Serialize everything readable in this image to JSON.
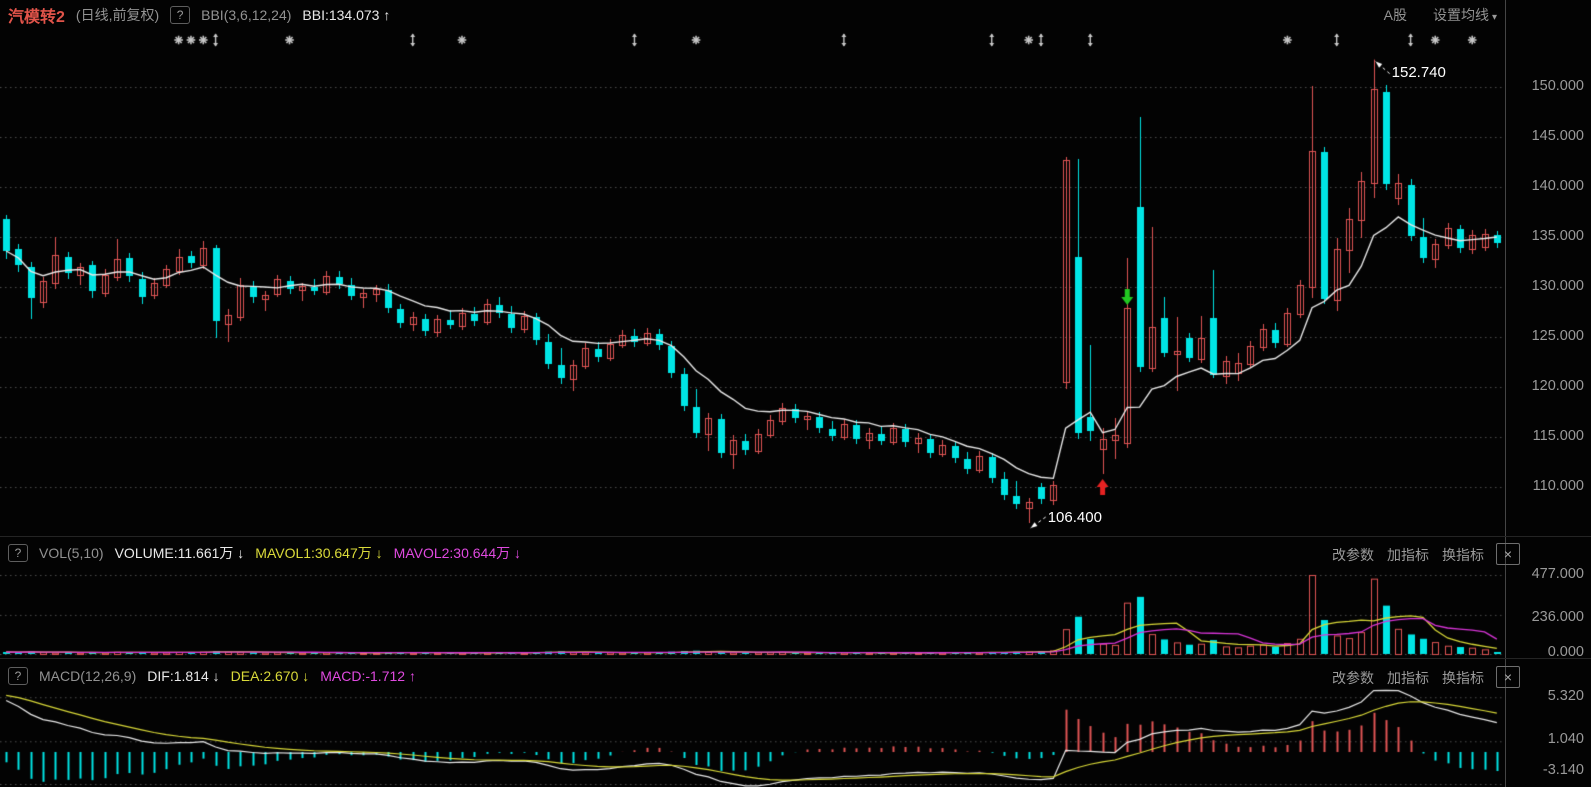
{
  "header": {
    "symbol": "汽模转2",
    "mode": "(日线,前复权)",
    "help": "?",
    "indicator_params": "BBI(3,6,12,24)",
    "indicator_value": "BBI:134.073 ↑",
    "market": "A股",
    "ma_settings": "设置均线",
    "caret": "▾"
  },
  "vol_pane": {
    "help": "?",
    "name": "VOL(5,10)",
    "volume": "VOLUME:11.661万 ↓",
    "mavol1": "MAVOL1:30.647万 ↓",
    "mavol2": "MAVOL2:30.644万 ↓",
    "menu": {
      "edit": "改参数",
      "add": "加指标",
      "switch": "换指标",
      "close": "×"
    },
    "axis": [
      "477.000",
      "236.000",
      "0.000"
    ]
  },
  "macd_pane": {
    "help": "?",
    "name": "MACD(12,26,9)",
    "dif": "DIF:1.814 ↓",
    "dea": "DEA:2.670 ↓",
    "macd": "MACD:-1.712 ↑",
    "menu": {
      "edit": "改参数",
      "add": "加指标",
      "switch": "换指标",
      "close": "×"
    },
    "axis": [
      "5.320",
      "1.040",
      "-3.140"
    ]
  },
  "main_axis": [
    "150.000",
    "145.000",
    "140.000",
    "135.000",
    "130.000",
    "125.000",
    "120.000",
    "115.000",
    "110.000"
  ],
  "annotations": {
    "high": {
      "index": 111,
      "price": 152.74,
      "label": "152.740"
    },
    "low": {
      "index": 83,
      "price": 106.4,
      "label": "106.400"
    }
  },
  "chart_data": {
    "type": "candlestick",
    "title": "汽模转2 日线 前复权",
    "overlay_line": "BBI(3,6,12,24)",
    "price_ylim": [
      105.5,
      155.9
    ],
    "price_gridlines": [
      150,
      145,
      140,
      135,
      130,
      125,
      120,
      115,
      110
    ],
    "volume_gridlines": [
      477,
      236,
      0
    ],
    "volume_ylim": [
      0,
      477
    ],
    "macd_gridlines": [
      5.32,
      1.04,
      -3.14
    ],
    "legend": {
      "up_candle": "red hollow",
      "down_candle": "cyan filled",
      "main_line": "BBI white",
      "vol_lines": [
        "MAVOL1 yellow",
        "MAVOL2 magenta"
      ],
      "macd_lines": [
        "DIF white",
        "DEA yellow"
      ]
    },
    "candles": [
      [
        136.8,
        137.2,
        132.8,
        133.6
      ],
      [
        133.8,
        134.3,
        131.5,
        132.2
      ],
      [
        132.0,
        132.5,
        126.8,
        128.9
      ],
      [
        128.5,
        131.0,
        127.9,
        130.6
      ],
      [
        130.4,
        135.0,
        129.8,
        133.2
      ],
      [
        133.0,
        133.5,
        130.8,
        131.4
      ],
      [
        131.2,
        132.4,
        130.2,
        132.0
      ],
      [
        132.2,
        132.6,
        128.9,
        129.6
      ],
      [
        129.4,
        131.8,
        129.0,
        131.2
      ],
      [
        131.0,
        134.8,
        130.6,
        132.8
      ],
      [
        132.9,
        133.4,
        130.5,
        131.1
      ],
      [
        130.8,
        131.5,
        128.3,
        129.0
      ],
      [
        129.2,
        130.9,
        128.8,
        130.4
      ],
      [
        130.2,
        132.2,
        129.9,
        131.8
      ],
      [
        131.6,
        133.8,
        131.2,
        133.0
      ],
      [
        133.1,
        133.6,
        131.9,
        132.4
      ],
      [
        132.2,
        134.6,
        131.8,
        133.9
      ],
      [
        133.9,
        134.2,
        124.9,
        126.6
      ],
      [
        126.3,
        127.8,
        124.5,
        127.2
      ],
      [
        127.0,
        130.9,
        126.6,
        130.2
      ],
      [
        130.0,
        130.6,
        128.4,
        129.0
      ],
      [
        128.8,
        129.6,
        127.6,
        129.2
      ],
      [
        129.3,
        131.2,
        129.0,
        130.8
      ],
      [
        130.6,
        131.1,
        129.3,
        129.8
      ],
      [
        129.7,
        130.4,
        128.6,
        130.1
      ],
      [
        130.0,
        130.8,
        129.2,
        129.6
      ],
      [
        129.5,
        131.6,
        129.2,
        131.1
      ],
      [
        131.0,
        131.6,
        129.8,
        130.3
      ],
      [
        130.2,
        130.9,
        128.7,
        129.1
      ],
      [
        129.0,
        129.8,
        127.9,
        129.4
      ],
      [
        129.3,
        130.2,
        128.5,
        129.8
      ],
      [
        129.7,
        130.3,
        127.4,
        127.9
      ],
      [
        127.8,
        128.3,
        125.9,
        126.4
      ],
      [
        126.3,
        127.5,
        125.6,
        127.0
      ],
      [
        126.8,
        127.3,
        125.1,
        125.6
      ],
      [
        125.5,
        127.2,
        125.0,
        126.8
      ],
      [
        126.7,
        127.7,
        125.8,
        126.2
      ],
      [
        126.1,
        127.9,
        125.7,
        127.4
      ],
      [
        127.3,
        128.0,
        126.1,
        126.6
      ],
      [
        126.5,
        128.8,
        126.2,
        128.3
      ],
      [
        128.2,
        129.0,
        126.9,
        127.4
      ],
      [
        127.3,
        128.1,
        125.4,
        125.9
      ],
      [
        125.8,
        127.6,
        125.4,
        127.1
      ],
      [
        127.0,
        127.4,
        124.2,
        124.7
      ],
      [
        124.5,
        125.3,
        121.8,
        122.3
      ],
      [
        122.2,
        123.9,
        120.3,
        120.9
      ],
      [
        120.8,
        122.7,
        119.6,
        122.2
      ],
      [
        122.1,
        124.4,
        121.8,
        123.9
      ],
      [
        123.8,
        124.5,
        122.5,
        123.0
      ],
      [
        122.9,
        124.8,
        122.6,
        124.3
      ],
      [
        124.2,
        125.7,
        123.9,
        125.2
      ],
      [
        125.1,
        125.8,
        124.0,
        124.5
      ],
      [
        124.4,
        125.9,
        124.1,
        125.4
      ],
      [
        125.3,
        125.8,
        123.7,
        124.2
      ],
      [
        124.1,
        124.6,
        120.9,
        121.4
      ],
      [
        121.3,
        121.9,
        117.6,
        118.1
      ],
      [
        118.0,
        119.8,
        114.9,
        115.4
      ],
      [
        115.3,
        117.4,
        113.6,
        116.9
      ],
      [
        116.8,
        117.3,
        112.9,
        113.4
      ],
      [
        113.3,
        115.2,
        111.8,
        114.7
      ],
      [
        114.6,
        115.3,
        113.2,
        113.7
      ],
      [
        113.6,
        115.8,
        113.3,
        115.3
      ],
      [
        115.2,
        117.2,
        114.9,
        116.7
      ],
      [
        116.6,
        118.4,
        116.2,
        117.9
      ],
      [
        117.8,
        118.3,
        116.4,
        116.9
      ],
      [
        116.8,
        117.6,
        115.7,
        117.1
      ],
      [
        117.0,
        117.5,
        115.4,
        115.9
      ],
      [
        115.8,
        116.6,
        114.6,
        115.1
      ],
      [
        115.0,
        116.8,
        114.7,
        116.3
      ],
      [
        116.2,
        116.7,
        114.3,
        114.8
      ],
      [
        114.7,
        115.9,
        113.8,
        115.4
      ],
      [
        115.3,
        116.1,
        114.2,
        114.6
      ],
      [
        114.5,
        116.4,
        114.2,
        115.9
      ],
      [
        115.8,
        116.3,
        114.0,
        114.5
      ],
      [
        114.4,
        115.4,
        113.4,
        114.9
      ],
      [
        114.8,
        115.2,
        112.9,
        113.4
      ],
      [
        113.3,
        114.7,
        113.0,
        114.2
      ],
      [
        114.1,
        114.6,
        112.4,
        112.9
      ],
      [
        112.8,
        113.5,
        111.3,
        111.8
      ],
      [
        111.7,
        113.6,
        111.4,
        113.1
      ],
      [
        113.0,
        113.4,
        110.4,
        110.9
      ],
      [
        110.8,
        111.5,
        108.7,
        109.2
      ],
      [
        109.1,
        110.6,
        107.8,
        108.3
      ],
      [
        107.9,
        108.9,
        106.4,
        108.5
      ],
      [
        110.0,
        110.4,
        108.3,
        108.8
      ],
      [
        108.7,
        110.6,
        108.2,
        110.2
      ],
      [
        120.5,
        143.0,
        119.8,
        142.7
      ],
      [
        133.0,
        142.8,
        114.8,
        115.4
      ],
      [
        117.0,
        124.2,
        114.6,
        115.6
      ],
      [
        113.8,
        115.9,
        111.3,
        114.8
      ],
      [
        114.7,
        116.9,
        112.8,
        115.2
      ],
      [
        114.4,
        132.9,
        113.9,
        127.9
      ],
      [
        138.0,
        147.0,
        121.5,
        122.0
      ],
      [
        121.9,
        136.0,
        121.5,
        126.0
      ],
      [
        126.9,
        129.0,
        123.0,
        123.4
      ],
      [
        123.3,
        127.0,
        119.6,
        123.6
      ],
      [
        124.9,
        125.4,
        122.5,
        122.9
      ],
      [
        122.8,
        127.1,
        122.4,
        124.9
      ],
      [
        126.9,
        131.7,
        120.9,
        121.2
      ],
      [
        121.1,
        123.1,
        120.3,
        122.6
      ],
      [
        121.4,
        123.4,
        120.6,
        122.4
      ],
      [
        122.3,
        124.6,
        121.9,
        124.1
      ],
      [
        124.0,
        126.3,
        123.6,
        125.8
      ],
      [
        125.7,
        126.4,
        123.9,
        124.4
      ],
      [
        124.3,
        127.9,
        124.0,
        127.4
      ],
      [
        127.3,
        130.7,
        126.9,
        130.2
      ],
      [
        130.0,
        150.1,
        128.9,
        143.6
      ],
      [
        143.5,
        144.0,
        128.3,
        128.8
      ],
      [
        128.7,
        134.9,
        127.6,
        133.8
      ],
      [
        133.7,
        137.9,
        131.4,
        136.8
      ],
      [
        136.7,
        141.5,
        134.9,
        140.6
      ],
      [
        140.4,
        152.74,
        138.9,
        149.8
      ],
      [
        149.5,
        150.2,
        139.7,
        140.3
      ],
      [
        138.9,
        141.3,
        138.2,
        140.4
      ],
      [
        140.2,
        140.8,
        134.6,
        135.1
      ],
      [
        135.0,
        136.9,
        132.4,
        132.9
      ],
      [
        132.8,
        134.8,
        131.9,
        134.3
      ],
      [
        134.2,
        136.4,
        133.8,
        135.9
      ],
      [
        135.8,
        136.2,
        133.4,
        133.9
      ],
      [
        133.8,
        135.7,
        133.3,
        135.2
      ],
      [
        134.0,
        135.8,
        133.6,
        135.3
      ],
      [
        135.2,
        135.6,
        133.9,
        134.4
      ]
    ],
    "volumes": [
      12,
      9,
      15,
      11,
      8,
      10,
      7,
      9,
      8,
      13,
      9,
      11,
      8,
      9,
      12,
      9,
      14,
      18,
      13,
      11,
      9,
      8,
      10,
      8,
      7,
      8,
      9,
      7,
      8,
      6,
      7,
      10,
      9,
      7,
      8,
      7,
      6,
      8,
      7,
      9,
      7,
      8,
      7,
      12,
      14,
      16,
      10,
      9,
      8,
      9,
      8,
      7,
      8,
      7,
      14,
      18,
      20,
      12,
      11,
      9,
      8,
      9,
      10,
      11,
      8,
      7,
      8,
      7,
      9,
      8,
      7,
      6,
      8,
      7,
      7,
      9,
      8,
      10,
      9,
      8,
      12,
      11,
      13,
      15,
      18,
      22,
      150,
      225,
      90,
      62,
      55,
      310,
      345,
      120,
      88,
      70,
      56,
      62,
      84,
      46,
      40,
      50,
      56,
      44,
      66,
      92,
      477,
      205,
      112,
      96,
      132,
      455,
      292,
      152,
      118,
      92,
      72,
      50,
      42,
      38,
      28,
      12
    ],
    "markers": [
      [
        14,
        "star"
      ],
      [
        15,
        "star"
      ],
      [
        16,
        "star"
      ],
      [
        17,
        "updown"
      ],
      [
        23,
        "star"
      ],
      [
        33,
        "updown"
      ],
      [
        37,
        "star"
      ],
      [
        51,
        "updown"
      ],
      [
        56,
        "star"
      ],
      [
        68,
        "updown"
      ],
      [
        80,
        "updown"
      ],
      [
        83,
        "star"
      ],
      [
        84,
        "updown"
      ],
      [
        88,
        "updown"
      ],
      [
        104,
        "star"
      ],
      [
        108,
        "updown"
      ],
      [
        114,
        "updown"
      ],
      [
        116,
        "star"
      ],
      [
        119,
        "star"
      ]
    ],
    "signals": [
      {
        "index": 89,
        "dir": "up"
      },
      {
        "index": 91,
        "dir": "down"
      }
    ],
    "colors": {
      "up": "#e05555",
      "down": "#00e5e5",
      "ma": "#e9e9e9",
      "mavol1": "#d8d838",
      "mavol2": "#d935d9",
      "grid": "#4f4f4f",
      "marker": "#c9c9c9",
      "signal_up": "#e62222",
      "signal_down": "#22c822",
      "anno": "#ffffff"
    }
  }
}
